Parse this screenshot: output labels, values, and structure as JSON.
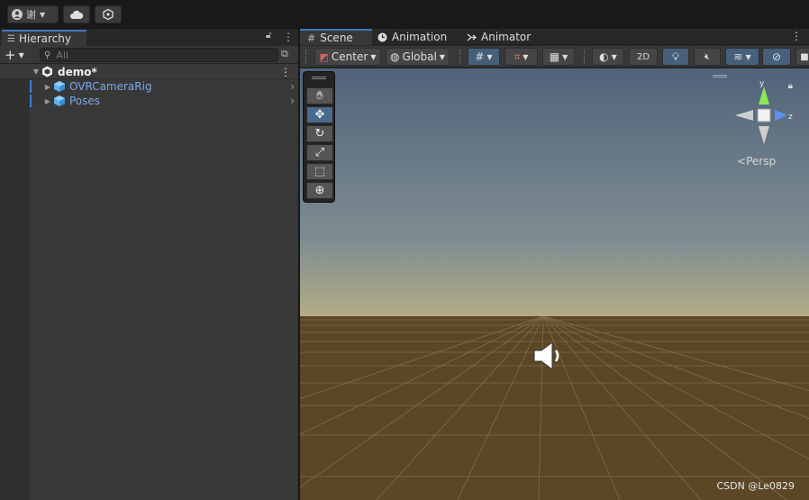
{
  "toolbar": {
    "account_initial": "谢",
    "account_icon": "account-icon",
    "cloud_icon": "cloud-icon",
    "collab_icon": "collab-icon"
  },
  "hierarchy": {
    "tab_label": "Hierarchy",
    "search_placeholder": "All",
    "add_label": "+",
    "scene_name": "demo*",
    "items": [
      {
        "label": "OVRCameraRig"
      },
      {
        "label": "Poses"
      }
    ]
  },
  "scene_view": {
    "tabs": [
      {
        "label": "Scene",
        "icon": "grid-icon"
      },
      {
        "label": "Animation",
        "icon": "clock-icon"
      },
      {
        "label": "Animator",
        "icon": "animator-icon"
      }
    ],
    "pivot_mode": "Center",
    "pivot_rotation": "Global",
    "mode_2d": "2D",
    "persp_label": "Persp",
    "gizmo_axes": {
      "y": "y",
      "z": "z"
    },
    "accent_color": "#3a79bb"
  },
  "watermark": "CSDN @Le0829"
}
